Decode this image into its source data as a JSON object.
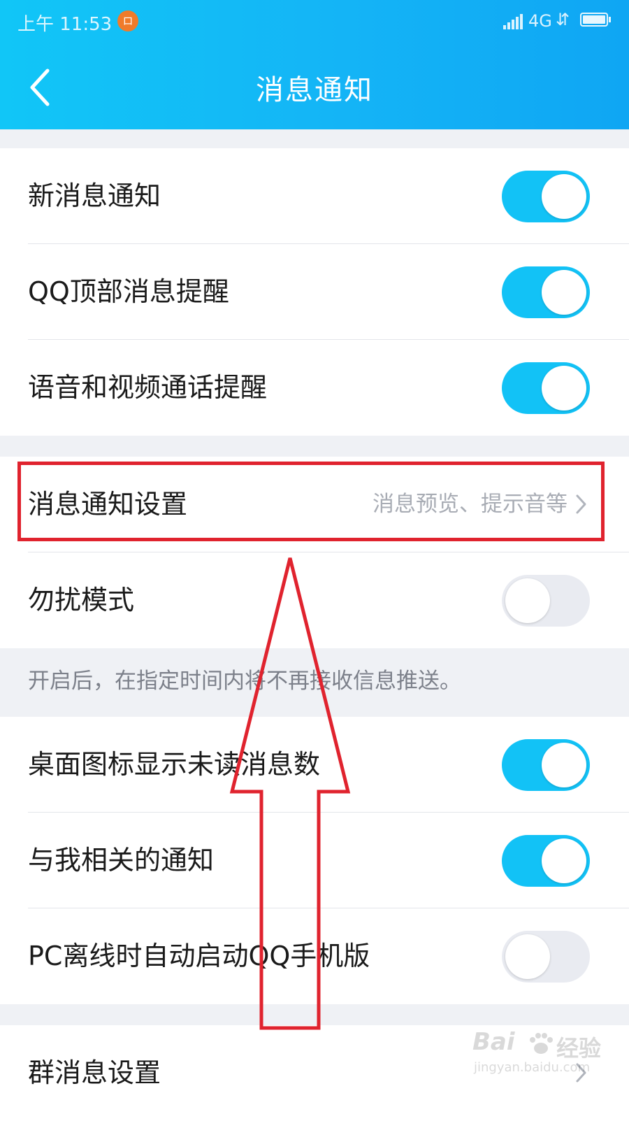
{
  "status_bar": {
    "time": "上午 11:53",
    "notification_badge": "ロ",
    "network": "4G",
    "data_arrows": "⇵"
  },
  "header": {
    "title": "消息通知",
    "back_icon": "chevron-left-icon"
  },
  "settings": [
    {
      "label": "新消息通知",
      "type": "toggle",
      "on": true
    },
    {
      "label": "QQ顶部消息提醒",
      "type": "toggle",
      "on": true
    },
    {
      "label": "语音和视频通话提醒",
      "type": "toggle",
      "on": true
    },
    {
      "label": "消息通知设置",
      "type": "link",
      "value": "消息预览、提示音等",
      "highlighted": true
    },
    {
      "label": "勿扰模式",
      "type": "toggle",
      "on": false
    },
    {
      "label": "桌面图标显示未读消息数",
      "type": "toggle",
      "on": true
    },
    {
      "label": "与我相关的通知",
      "type": "toggle",
      "on": true
    },
    {
      "label": "PC离线时自动启动QQ手机版",
      "type": "toggle",
      "on": false
    },
    {
      "label": "群消息设置",
      "type": "link",
      "value": ""
    }
  ],
  "dnd_hint": "开启后，在指定时间内将不再接收信息推送。",
  "colors": {
    "accent": "#12c2f6",
    "header_gradient_start": "#11c6f7",
    "header_gradient_end": "#0fa6f3",
    "annotation_red": "#e0232e"
  },
  "watermark": {
    "brand": "Bai",
    "brand_cn": "经验",
    "url": "jingyan.baidu.com"
  }
}
